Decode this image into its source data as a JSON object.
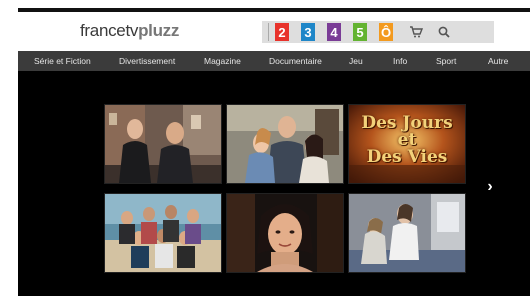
{
  "header": {
    "logo": {
      "part1": "francetv",
      "part2": "pluzz"
    },
    "channels": [
      {
        "label": "2",
        "color": "#e8322b"
      },
      {
        "label": "3",
        "color": "#1e86c8"
      },
      {
        "label": "4",
        "color": "#7a3c96"
      },
      {
        "label": "5",
        "color": "#63b331"
      },
      {
        "label": "Ô",
        "color": "#f39a1f"
      }
    ],
    "icons": [
      "cart-icon",
      "search-icon"
    ]
  },
  "nav": {
    "items": [
      "Série et Fiction",
      "Divertissement",
      "Magazine",
      "Documentaire",
      "Jeu",
      "Info",
      "Sport",
      "Autre"
    ]
  },
  "carousel": {
    "tiles": [
      {
        "name": "tile-street-scene"
      },
      {
        "name": "tile-family-portrait"
      },
      {
        "name": "tile-des-jours-et-des-vies",
        "title": "Des Jours et Des Vies"
      },
      {
        "name": "tile-beach-group"
      },
      {
        "name": "tile-woman-portrait"
      },
      {
        "name": "tile-interior-scene"
      }
    ],
    "next_arrow": "›"
  }
}
